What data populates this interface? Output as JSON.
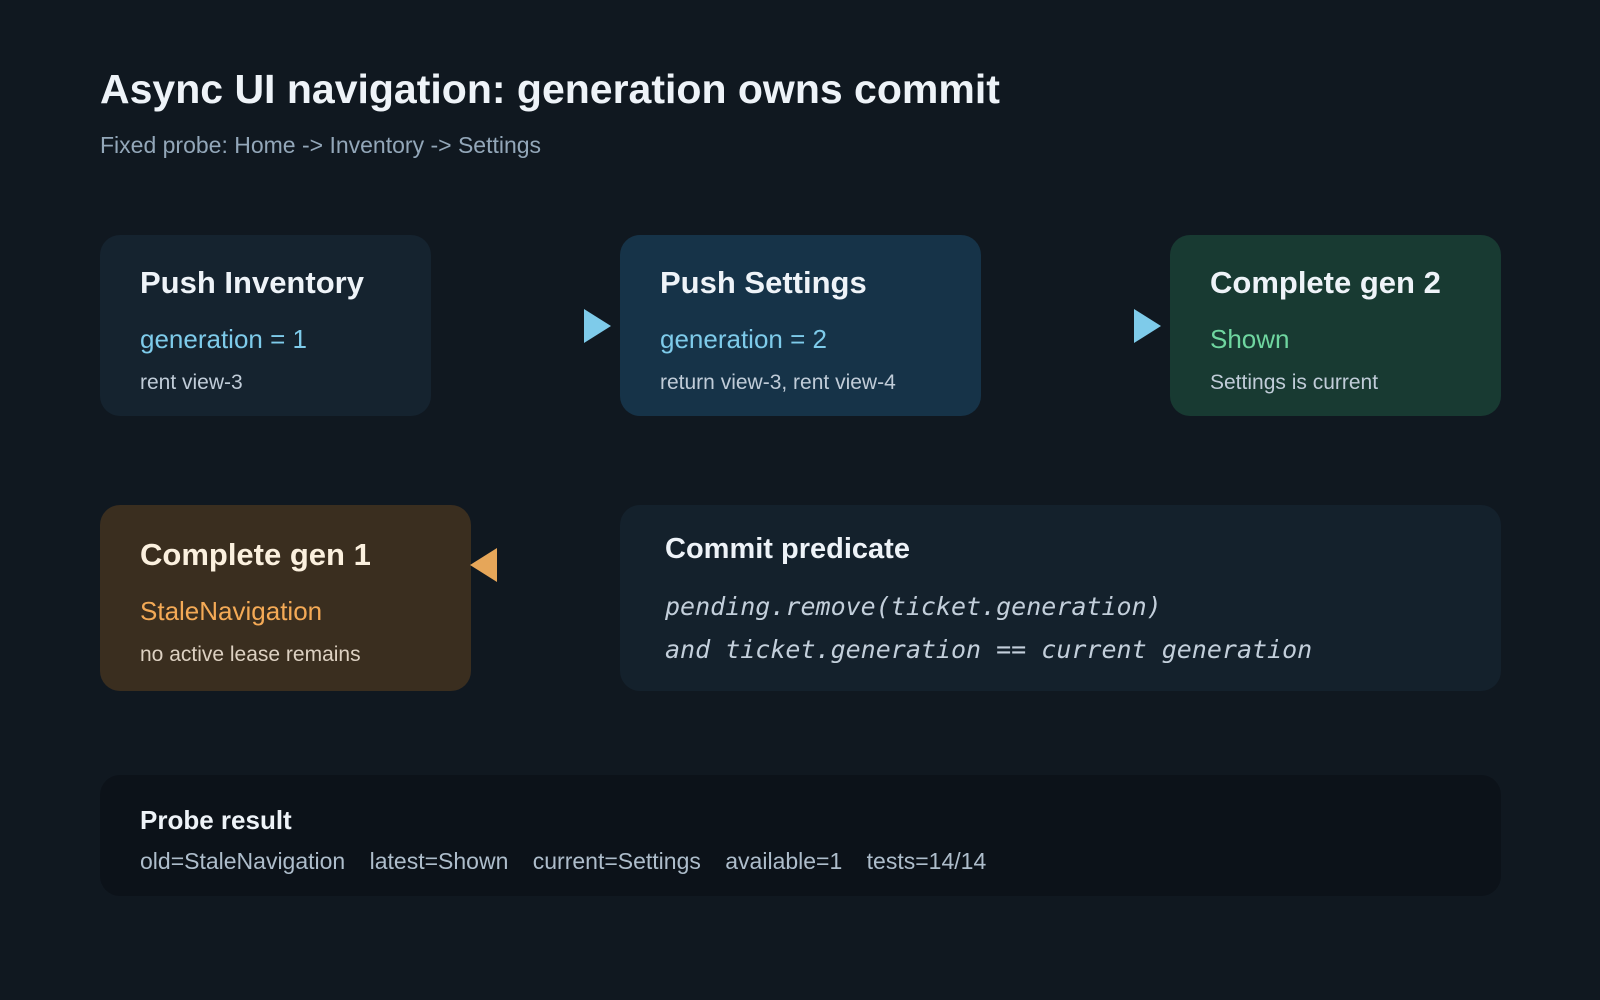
{
  "header": {
    "title": "Async UI navigation: generation owns commit",
    "subtitle": "Fixed probe: Home -> Inventory -> Settings"
  },
  "colors": {
    "background": "#101820",
    "blue_accent": "#7ecbea",
    "green_accent": "#6fd6a0",
    "orange_accent": "#f4aa56"
  },
  "steps": [
    {
      "title": "Push Inventory",
      "state": "generation = 1",
      "note": "rent view-3"
    },
    {
      "title": "Push Settings",
      "state": "generation = 2",
      "note": "return view-3, rent view-4"
    },
    {
      "title": "Complete gen 2",
      "state": "Shown",
      "note": "Settings is current"
    },
    {
      "title": "Complete gen 1",
      "state": "StaleNavigation",
      "note": "no active lease remains"
    }
  ],
  "predicate": {
    "title": "Commit predicate",
    "lines": [
      "pending.remove(ticket.generation)",
      "and ticket.generation == current generation"
    ]
  },
  "probe_result": {
    "title": "Probe result",
    "values": [
      "old=StaleNavigation",
      "latest=Shown",
      "current=Settings",
      "available=1",
      "tests=14/14"
    ]
  }
}
